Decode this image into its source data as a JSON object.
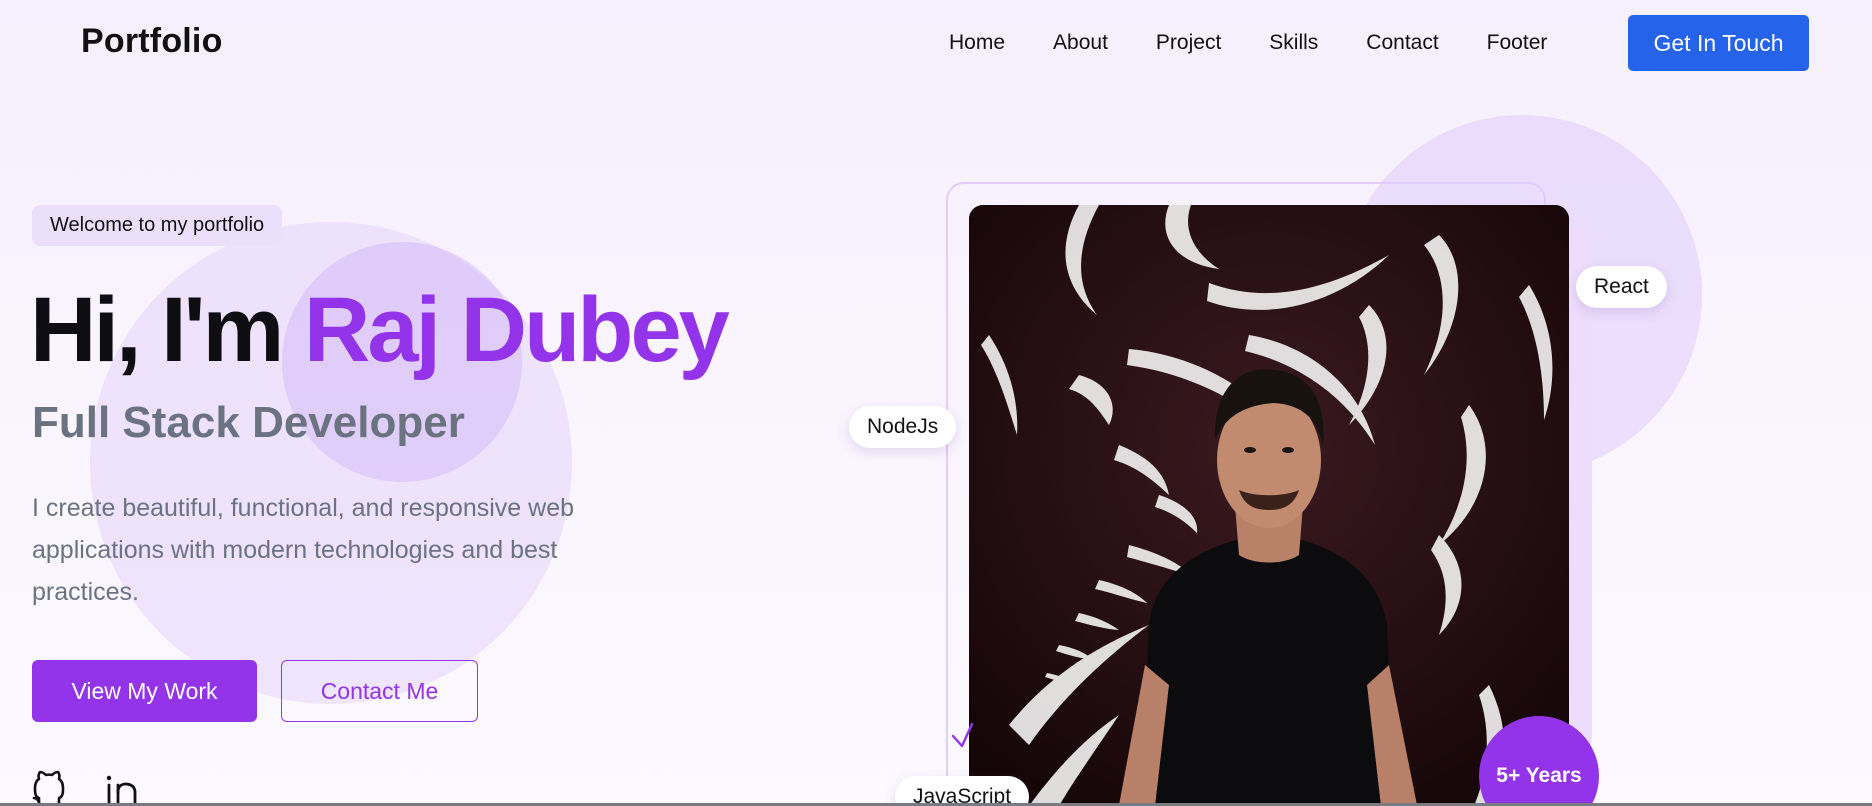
{
  "header": {
    "logo": "Portfolio",
    "nav": [
      "Home",
      "About",
      "Project",
      "Skills",
      "Contact",
      "Footer"
    ],
    "cta": "Get In Touch"
  },
  "hero": {
    "badge": "Welcome to my portfolio",
    "title_prefix": "Hi, I'm ",
    "title_name": "Raj Dubey",
    "subtitle": "Full Stack Developer",
    "description": "I create beautiful, functional, and responsive web applications with modern technologies and best practices.",
    "primary_button": "View My Work",
    "secondary_button": "Contact Me",
    "social_icons": [
      "github-icon",
      "linkedin-icon"
    ]
  },
  "profile": {
    "tags": [
      "React",
      "NodeJs",
      "JavaScript"
    ],
    "experience_badge": "5+ Years"
  },
  "colors": {
    "accent": "#9333ea",
    "cta": "#2563eb",
    "muted_text": "#6b7280",
    "background": "#f6effd"
  }
}
